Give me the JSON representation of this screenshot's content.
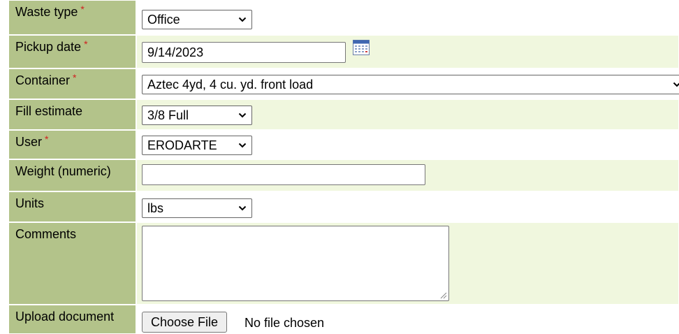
{
  "form": {
    "waste_type": {
      "label": "Waste type",
      "required_mark": "*",
      "value": "Office"
    },
    "pickup_date": {
      "label": "Pickup date",
      "required_mark": "*",
      "value": "9/14/2023",
      "icon": "calendar-icon"
    },
    "container": {
      "label": "Container",
      "required_mark": "*",
      "value": "Aztec 4yd, 4 cu. yd. front load"
    },
    "fill_estimate": {
      "label": "Fill estimate",
      "value": "3/8 Full"
    },
    "user": {
      "label": "User",
      "required_mark": "*",
      "value": "ERODARTE"
    },
    "weight": {
      "label": "Weight (numeric)",
      "value": ""
    },
    "units": {
      "label": "Units",
      "value": "lbs"
    },
    "comments": {
      "label": "Comments",
      "value": ""
    },
    "upload": {
      "label": "Upload document",
      "button_label": "Choose File",
      "status": "No file chosen"
    }
  },
  "colors": {
    "label_bg": "#b3c38a",
    "value_bg_light": "#f0f7de",
    "required": "#d02020"
  }
}
